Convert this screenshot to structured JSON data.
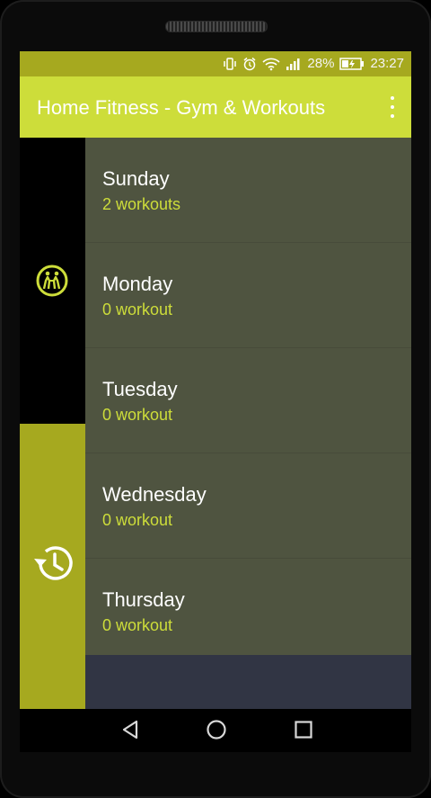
{
  "status": {
    "battery_percent": "28%",
    "time": "23:27"
  },
  "app": {
    "title": "Home Fitness - Gym & Workouts"
  },
  "days": [
    {
      "name": "Sunday",
      "count": "2 workouts"
    },
    {
      "name": "Monday",
      "count": "0 workout"
    },
    {
      "name": "Tuesday",
      "count": "0 workout"
    },
    {
      "name": "Wednesday",
      "count": "0 workout"
    },
    {
      "name": "Thursday",
      "count": "0 workout"
    }
  ],
  "colors": {
    "accent": "#cddd3a",
    "status_bar": "#a6a91f",
    "list_bg": "#4f5440",
    "footer_bg": "#313544"
  },
  "icons": [
    "vibrate-icon",
    "alarm-icon",
    "wifi-icon",
    "signal-icon",
    "battery-icon",
    "overflow-menu-icon",
    "gym-icon",
    "history-icon",
    "back-icon",
    "home-icon",
    "recent-apps-icon"
  ]
}
